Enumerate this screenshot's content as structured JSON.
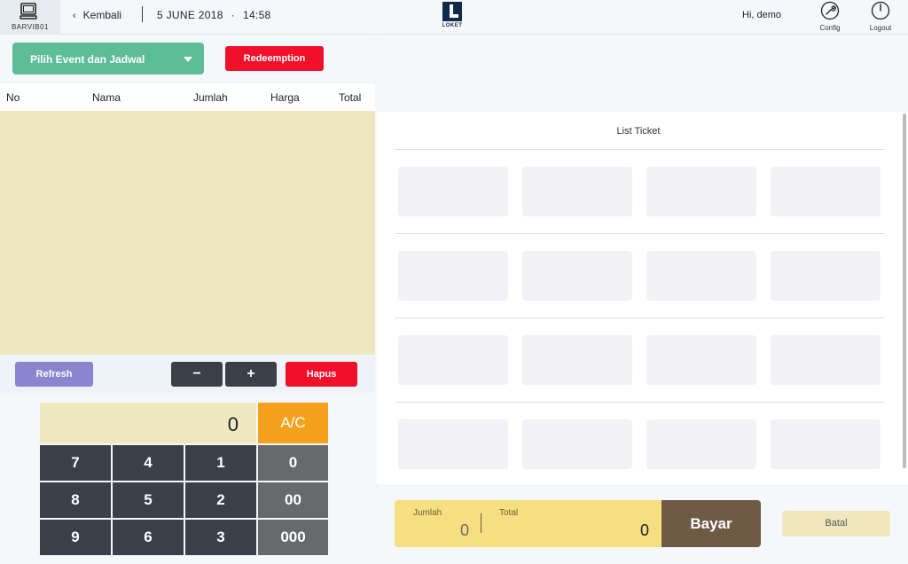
{
  "header": {
    "device_label": "BARVIB01",
    "back_label": "Kembali",
    "date": "5 JUNE 2018",
    "time": "14:58",
    "logo_text": "LOKET",
    "greeting": "Hi, demo",
    "config_label": "Config",
    "logout_label": "Logout"
  },
  "left": {
    "event_select_label": "Pilih Event dan Jadwal",
    "redemption_label": "Redeemption",
    "columns": [
      "No",
      "Nama",
      "Jumlah",
      "Harga",
      "Total"
    ],
    "refresh_label": "Refresh",
    "minus_label": "−",
    "plus_label": "+",
    "hapus_label": "Hapus"
  },
  "keypad": {
    "display_value": "0",
    "clear_label": "A/C",
    "keys": [
      "7",
      "4",
      "1",
      "0",
      "8",
      "5",
      "2",
      "00",
      "9",
      "6",
      "3",
      "000"
    ]
  },
  "right": {
    "list_title": "List Ticket",
    "jumlah_label": "Jumlah",
    "jumlah_value": "0",
    "total_label": "Total",
    "total_value": "0",
    "bayar_label": "Bayar",
    "batal_label": "Batal"
  },
  "colors": {
    "accent_green": "#5dbd97",
    "danger_red": "#f1102a",
    "amber": "#f4a21e",
    "cart_bg": "#efe7bf",
    "pay_bg": "#f6df80",
    "pay_button": "#6e5a45"
  }
}
